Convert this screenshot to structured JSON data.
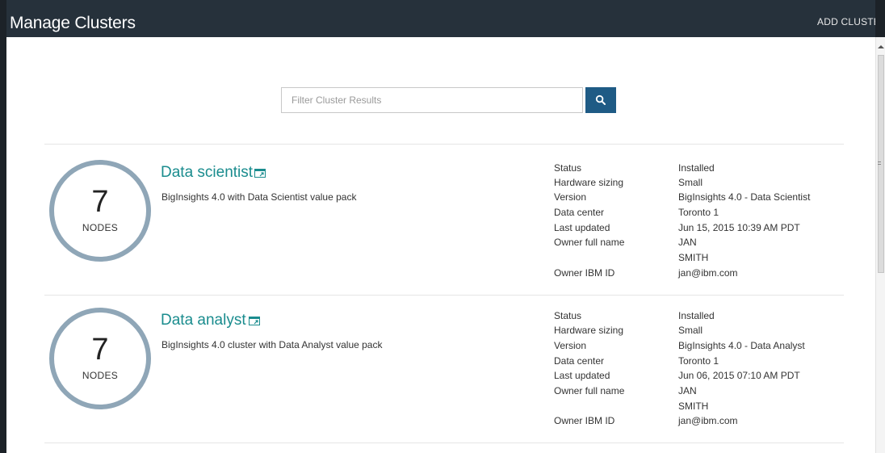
{
  "header": {
    "title": "Manage Clusters",
    "add_cluster_label": "ADD CLUSTER"
  },
  "search": {
    "placeholder": "Filter Cluster Results",
    "value": ""
  },
  "clusters": [
    {
      "node_count": "7",
      "node_label": "NODES",
      "name": "Data scientist",
      "description": "BigInsights 4.0 with Data Scientist value pack",
      "details": {
        "status_label": "Status",
        "status": "Installed",
        "hardware_label": "Hardware sizing",
        "hardware": "Small",
        "version_label": "Version",
        "version": "BigInsights 4.0 - Data Scientist",
        "datacenter_label": "Data center",
        "datacenter": "Toronto 1",
        "updated_label": "Last updated",
        "updated": "Jun 15, 2015 10:39 AM PDT",
        "owner_label": "Owner full name",
        "owner_first": "JAN",
        "owner_last": "SMITH",
        "ibmid_label": "Owner IBM ID",
        "ibmid": "jan@ibm.com"
      }
    },
    {
      "node_count": "7",
      "node_label": "NODES",
      "name": "Data analyst",
      "description": "BigInsights 4.0 cluster with Data Analyst value pack",
      "details": {
        "status_label": "Status",
        "status": "Installed",
        "hardware_label": "Hardware sizing",
        "hardware": "Small",
        "version_label": "Version",
        "version": "BigInsights 4.0 - Data Analyst",
        "datacenter_label": "Data center",
        "datacenter": "Toronto 1",
        "updated_label": "Last updated",
        "updated": "Jun 06, 2015 07:10 AM PDT",
        "owner_label": "Owner full name",
        "owner_first": "JAN",
        "owner_last": "SMITH",
        "ibmid_label": "Owner IBM ID",
        "ibmid": "jan@ibm.com"
      }
    }
  ],
  "colors": {
    "header_bg": "#26313b",
    "accent_button": "#1f5b85",
    "cluster_link": "#1a8c8e",
    "node_ring": "#8fa6b7"
  },
  "icons": {
    "search": "search-icon",
    "launch": "external-launch-icon"
  }
}
